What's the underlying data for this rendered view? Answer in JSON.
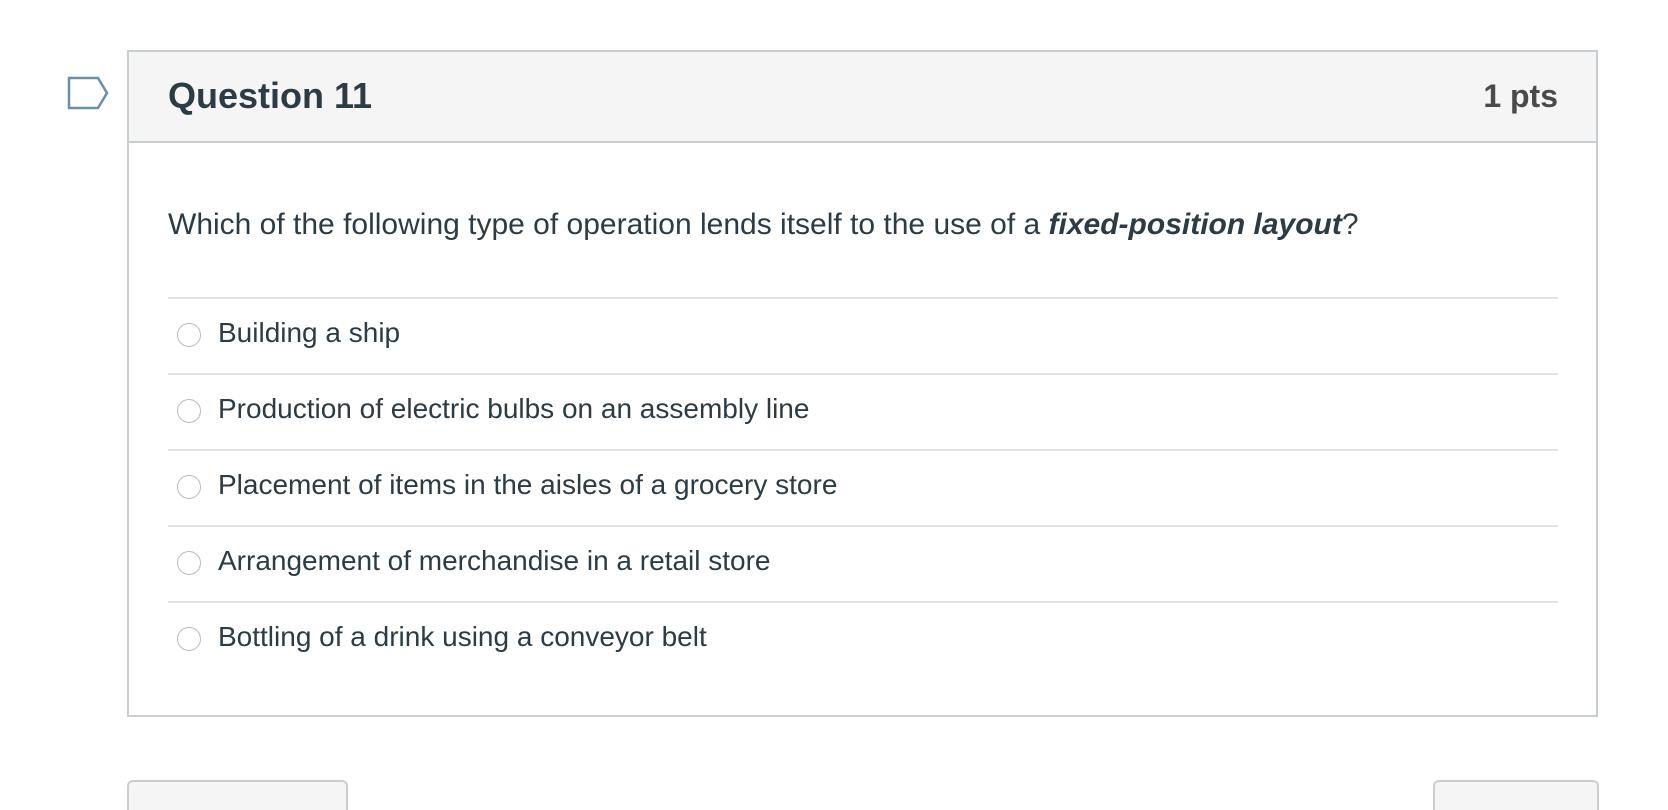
{
  "flag": {
    "icon": "flag-question-icon"
  },
  "question": {
    "title": "Question 11",
    "points": "1 pts",
    "text_before": "Which of the following type of operation lends itself to the use of a ",
    "text_emphasis": "fixed-position layout",
    "text_after": "?"
  },
  "answers": [
    {
      "label": "Building a ship"
    },
    {
      "label": "Production of electric bulbs on an assembly line"
    },
    {
      "label": "Placement of items in the aisles of a grocery store"
    },
    {
      "label": "Arrangement of merchandise in a retail store"
    },
    {
      "label": "Bottling of a drink using a conveyor belt"
    }
  ],
  "colors": {
    "text": "#2d3b45",
    "header_bg": "#f5f5f5",
    "border": "#c7cdd1",
    "divider": "#dfe3e6",
    "flag_stroke": "#6b8fa8"
  }
}
